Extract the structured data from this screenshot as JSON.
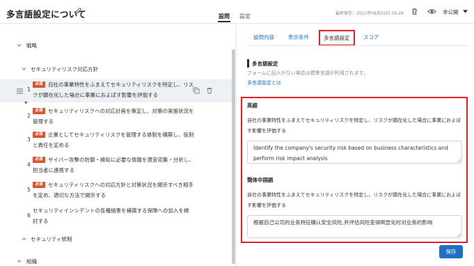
{
  "header": {
    "title": "多言語設定について",
    "tabs": [
      "設問",
      "設定"
    ],
    "saved_text": "最終保存：2022年08月02日 09:29",
    "visibility": "非公開"
  },
  "tree": {
    "l1_top": "戦略",
    "l2": "セキュリティリスク対応方針",
    "badge": "必須",
    "items": [
      {
        "num": "1",
        "text": "自社の事業特性をふまえてセキュリティリスクを特定し、リスクが顕在化した場合に事業におよぼす影響を評価する"
      },
      {
        "num": "2",
        "text": "セキュリティリスクへの対応計画を策定し、対策の実施状況を管理する"
      },
      {
        "num": "3",
        "text": "企業としてセキュリティリスクを管理する体制を構築し、役割と責任を定める"
      },
      {
        "num": "4",
        "text": "サイバー攻撃の防御・検知に必要な情報を適宜収集・分析し、担当者に連携する"
      },
      {
        "num": "5",
        "text": "セキュリティリスクへの対応方針と対策状況を開示すべき相手を定め、適切な方法で開示する"
      },
      {
        "num": "6",
        "text": "セキュリティインシデントの各種損害を補償する保険への加入を検討する"
      }
    ],
    "l1_mid": "セキュリティ統制",
    "l1_bottom": "組織"
  },
  "subtabs": [
    "設問内容",
    "表示条件",
    "多言語設定",
    "スコア"
  ],
  "section": {
    "title": "多言語設定",
    "desc": "フォームに記入がない場合は標準言語が利用されます。",
    "link": "多言語設定とは"
  },
  "languages": [
    {
      "name": "英語",
      "source": "自社の事業特性をふまえてセキュリティリスクを特定し、リスクが顕在化した場合に事業におよぼす影響を評価する",
      "translation": "Identify the company's security risk based on business characteristics and perform risk impact analysis"
    },
    {
      "name": "簡体中国語",
      "source": "自社の事業特性をふまえてセキュリティリスクを特定し、リスクが顕在化した場合に事業におよぼす影響を評価する",
      "translation": "根据自己公司的业务特征确认安全风险,并评估风险变得明显化时对业务的影响"
    }
  ],
  "save_label": "保存",
  "colors": {
    "accent": "#1f6fc4",
    "badge": "#d9542b",
    "highlight": "#e02020",
    "selected_row": "#edf0f4"
  }
}
